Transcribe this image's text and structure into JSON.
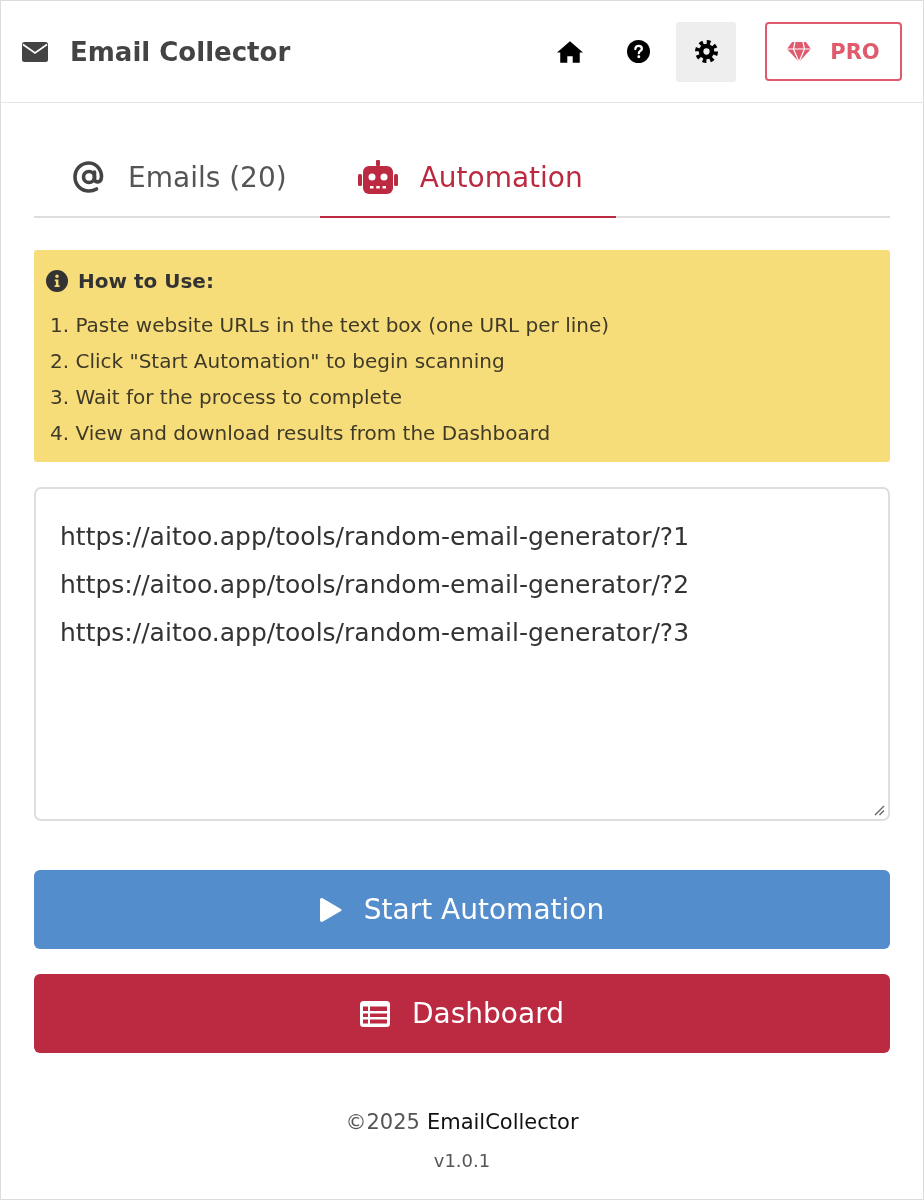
{
  "header": {
    "title": "Email Collector",
    "nav_buttons": [
      {
        "kind": "home",
        "selected": false
      },
      {
        "kind": "help",
        "selected": false
      },
      {
        "kind": "settings",
        "selected": true
      }
    ],
    "pro_button": {
      "label": "PRO"
    }
  },
  "tabs": [
    {
      "kind": "emails",
      "label": "Emails (20)",
      "selected": false
    },
    {
      "kind": "automation",
      "label": "Automation",
      "selected": true
    }
  ],
  "instructions": {
    "title": "How to Use:",
    "steps": [
      "1. Paste website URLs in the text box (one URL per line)",
      "2. Click \"Start Automation\" to begin scanning",
      "3. Wait for the process to complete",
      "4. View and download results from the Dashboard"
    ]
  },
  "url_input": {
    "value": "https://aitoo.app/tools/random-email-generator/?1\nhttps://aitoo.app/tools/random-email-generator/?2\nhttps://aitoo.app/tools/random-email-generator/?3"
  },
  "buttons": [
    {
      "kind": "start",
      "label": "Start Automation"
    },
    {
      "kind": "dashboard",
      "label": "Dashboard"
    }
  ],
  "footer": {
    "copyright": "©2025",
    "brand": "EmailCollector",
    "version": "v1.0.1"
  }
}
